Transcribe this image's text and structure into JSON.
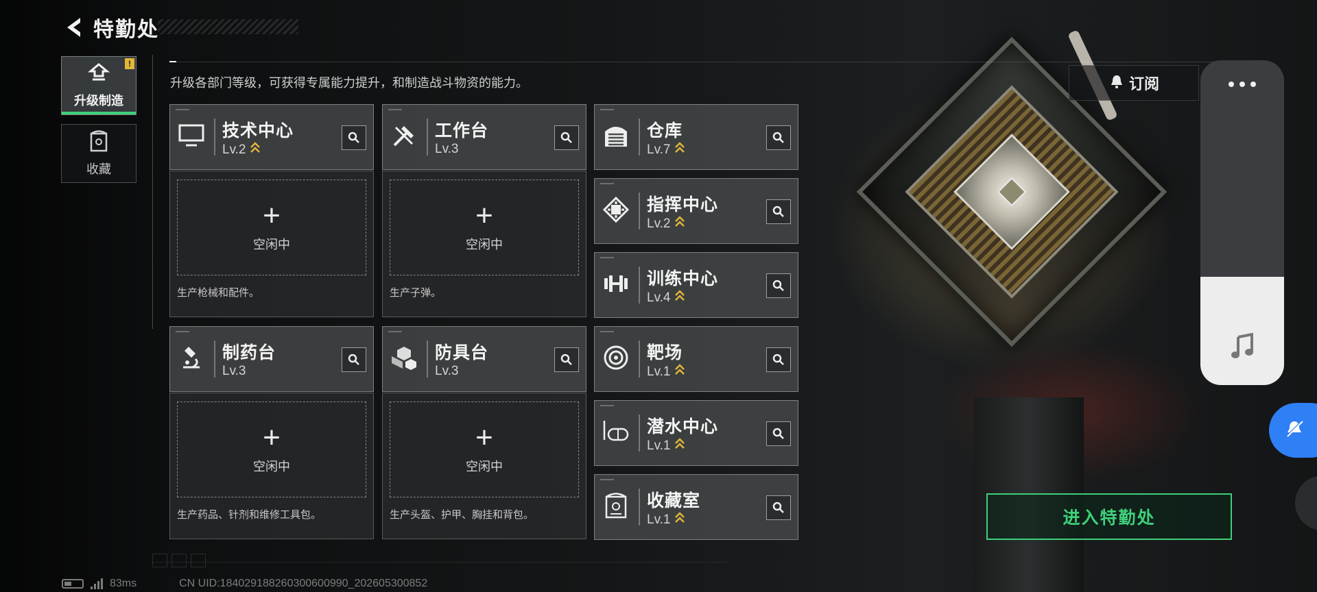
{
  "header": {
    "title": "特勤处"
  },
  "tabs": [
    {
      "label": "升级制造",
      "active": true,
      "badge": "!"
    },
    {
      "label": "收藏",
      "active": false
    }
  ],
  "description": "升级各部门等级，可获得专属能力提升，和制造战斗物资的能力。",
  "facilities": {
    "tech_center": {
      "name": "技术中心",
      "level": "Lv.2",
      "icon": "monitor-icon",
      "upgradable": true
    },
    "workbench": {
      "name": "工作台",
      "level": "Lv.3",
      "icon": "hammer-icon",
      "upgradable": false
    },
    "warehouse": {
      "name": "仓库",
      "level": "Lv.7",
      "icon": "warehouse-icon",
      "upgradable": true
    },
    "command_center": {
      "name": "指挥中心",
      "level": "Lv.2",
      "icon": "chip-icon",
      "upgradable": true
    },
    "training_center": {
      "name": "训练中心",
      "level": "Lv.4",
      "icon": "dumbbell-icon",
      "upgradable": true
    },
    "pharmacy": {
      "name": "制药台",
      "level": "Lv.3",
      "icon": "microscope-icon",
      "upgradable": false
    },
    "armor_bench": {
      "name": "防具台",
      "level": "Lv.3",
      "icon": "cubes-icon",
      "upgradable": false
    },
    "shooting_range": {
      "name": "靶场",
      "level": "Lv.1",
      "icon": "target-icon",
      "upgradable": true
    },
    "diving_center": {
      "name": "潜水中心",
      "level": "Lv.1",
      "icon": "diving-mask-icon",
      "upgradable": true
    },
    "collection_room": {
      "name": "收藏室",
      "level": "Lv.1",
      "icon": "trophy-case-icon",
      "upgradable": true
    }
  },
  "production": {
    "tech_center": {
      "status": "空闲中",
      "desc": "生产枪械和配件。"
    },
    "workbench": {
      "status": "空闲中",
      "desc": "生产子弹。"
    },
    "pharmacy": {
      "status": "空闲中",
      "desc": "生产药品、针剂和维修工具包。"
    },
    "armor_bench": {
      "status": "空闲中",
      "desc": "生产头盔、护甲、胸挂和背包。"
    }
  },
  "subscribe": {
    "label": "订阅"
  },
  "enter_button": {
    "label": "进入特勤处"
  },
  "footer": {
    "ping": "83ms",
    "uid": "CN UID:1840291882603006009​90_202605300852"
  },
  "colors": {
    "accent": "#3fd07a",
    "badge": "#e2b63a",
    "edge_button": "#2f7ff5"
  }
}
